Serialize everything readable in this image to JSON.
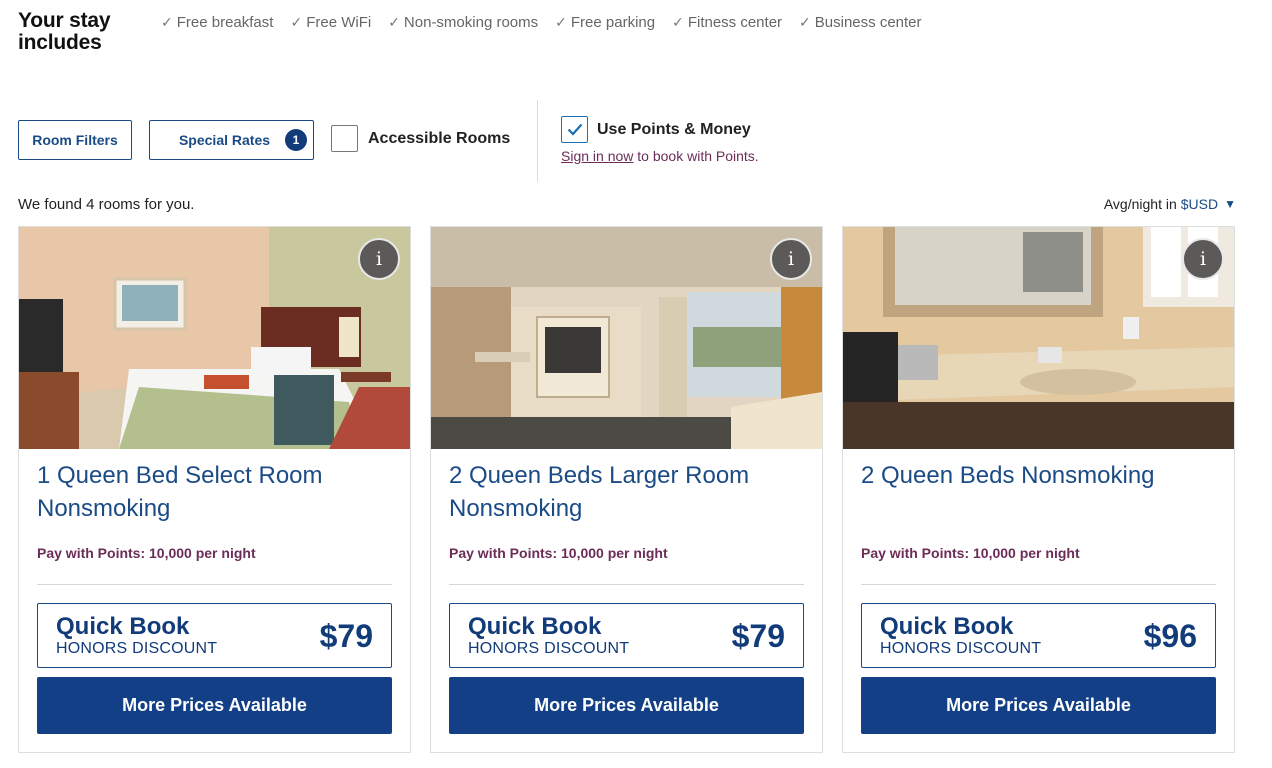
{
  "stay": {
    "title": "Your stay includes",
    "amenities": [
      {
        "check": "✓",
        "label": "Free breakfast"
      },
      {
        "check": "✓",
        "label": "Free WiFi"
      },
      {
        "check": "✓",
        "label": "Non-smoking rooms"
      },
      {
        "check": "✓",
        "label": "Free parking"
      },
      {
        "check": "✓",
        "label": "Fitness center"
      },
      {
        "check": "✓",
        "label": "Business center"
      }
    ]
  },
  "filters": {
    "room_filters_label": "Room Filters",
    "special_rates_label": "Special Rates",
    "special_rates_count": "1",
    "accessible_label": "Accessible Rooms",
    "accessible_checked": false,
    "points_label": "Use Points & Money",
    "points_checked": true,
    "signin_link": "Sign in now",
    "signin_text": " to book with Points."
  },
  "results": {
    "found_text": "We found 4 rooms for you.",
    "avg_label": "Avg/night in",
    "currency": "$USD"
  },
  "colors": {
    "brand_blue": "#123f86",
    "points_purple": "#6b2d58"
  },
  "rooms": [
    {
      "title": "1 Queen Bed Select Room Nonsmoking",
      "points": "Pay with Points: 10,000 per night",
      "quick_book": "Quick Book",
      "rate_name": "HONORS DISCOUNT",
      "price": "$79",
      "more_label": "More Prices Available",
      "info_icon": "i"
    },
    {
      "title": "2 Queen Beds Larger Room Nonsmoking",
      "points": "Pay with Points: 10,000 per night",
      "quick_book": "Quick Book",
      "rate_name": "HONORS DISCOUNT",
      "price": "$79",
      "more_label": "More Prices Available",
      "info_icon": "i"
    },
    {
      "title": "2 Queen Beds Nonsmoking",
      "points": "Pay with Points: 10,000 per night",
      "quick_book": "Quick Book",
      "rate_name": "HONORS DISCOUNT",
      "price": "$96",
      "more_label": "More Prices Available",
      "info_icon": "i"
    }
  ]
}
